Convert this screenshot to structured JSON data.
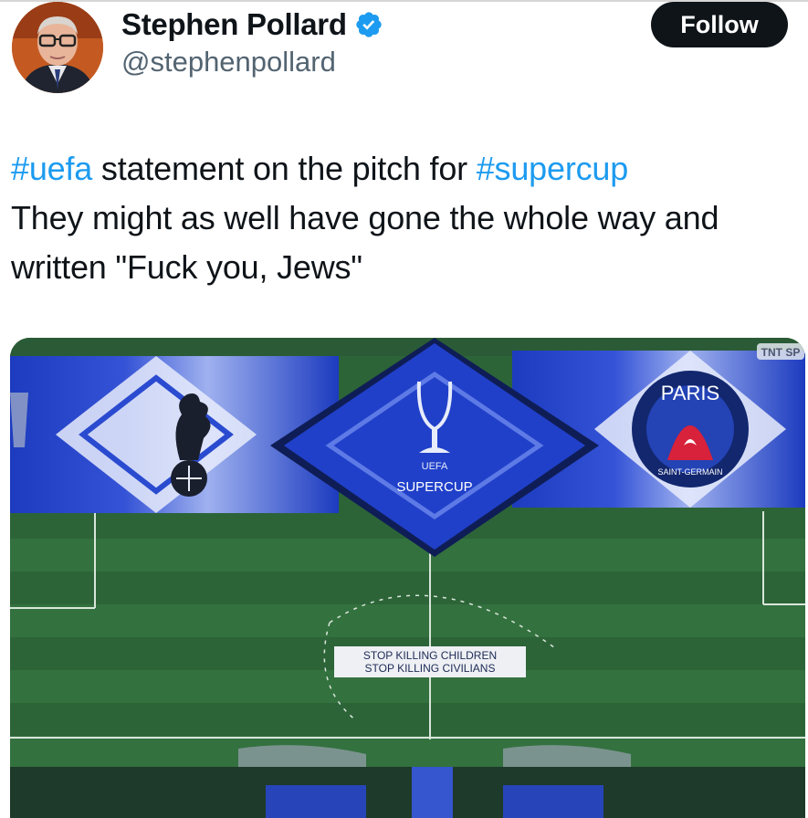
{
  "author": {
    "name": "Stephen Pollard",
    "handle": "@stephenpollard",
    "verified": true,
    "avatar_icon": "profile-photo"
  },
  "follow_button": {
    "label": "Follow"
  },
  "tweet": {
    "line1": {
      "hashtag1": "#uefa",
      "mid": " statement on the pitch for ",
      "hashtag2": "#supercup"
    },
    "line2": "They might as well have gone the whole way and",
    "line3": "written \"Fuck you, Jews\""
  },
  "media": {
    "broadcaster_bug": "TNT SP",
    "center_banner": {
      "top": "UEFA",
      "bottom": "SUPERCUP"
    },
    "right_crest": {
      "top": "PARIS",
      "bottom": "SAINT-GERMAIN"
    },
    "pitch_banner": {
      "line1": "STOP KILLING CHILDREN",
      "line2": "STOP KILLING CIVILIANS"
    },
    "left_club_icon": "cockerel-on-ball-icon",
    "trophy_icon": "trophy-icon"
  },
  "colors": {
    "hashtag": "#1d9bf0",
    "verified": "#1d9bf0",
    "follow_bg": "#0f1419",
    "handle": "#536471",
    "banner_blue": "#1d3fc4",
    "pitch_green": "#2f6b3c"
  }
}
